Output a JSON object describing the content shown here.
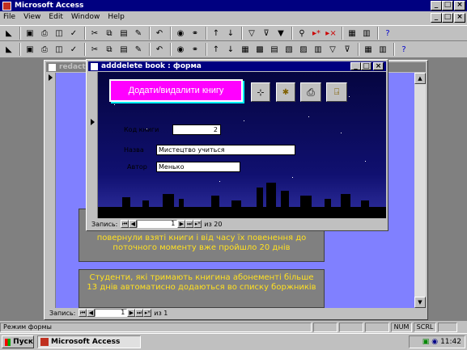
{
  "app": {
    "title": "Microsoft Access"
  },
  "menu": [
    "File",
    "View",
    "Edit",
    "Window",
    "Help"
  ],
  "back_form": {
    "title": "redactor",
    "record_label": "Запись:",
    "record_number": "1",
    "record_total": "из 1",
    "message1": "повернули взяті книги і від часу їх повенення до поточного моменту вже пройшло 20 днів",
    "message2": "Студенти, які тримають книгина абонементі більше 13 днів автоматисно додаються во списку боржників"
  },
  "front_form": {
    "title": "adddelete book : форма",
    "heading": "Додати/видалити книгу",
    "buttons": [
      "add-record",
      "save-record",
      "print",
      "exit"
    ],
    "fields": [
      {
        "label": "Код книги",
        "value": "2"
      },
      {
        "label": "Назва",
        "value": "Мистецтво учиться"
      },
      {
        "label": "Автор",
        "value": "Менько"
      }
    ],
    "record_label": "Запись:",
    "record_number": "1",
    "record_total": "из 20"
  },
  "statusbar": {
    "mode": "Режим формы",
    "indicators": [
      "NUM",
      "SCRL"
    ]
  },
  "taskbar": {
    "start": "Пуск",
    "task": "Microsoft Access",
    "clock": "11:42"
  },
  "colors": {
    "title_blue": "#000080",
    "mdi_bg": "#808080",
    "form_back": "#8080ff",
    "night_sky": "#0a0a50",
    "heading_magenta": "#ff00ff",
    "msg_text": "#ffe020"
  }
}
